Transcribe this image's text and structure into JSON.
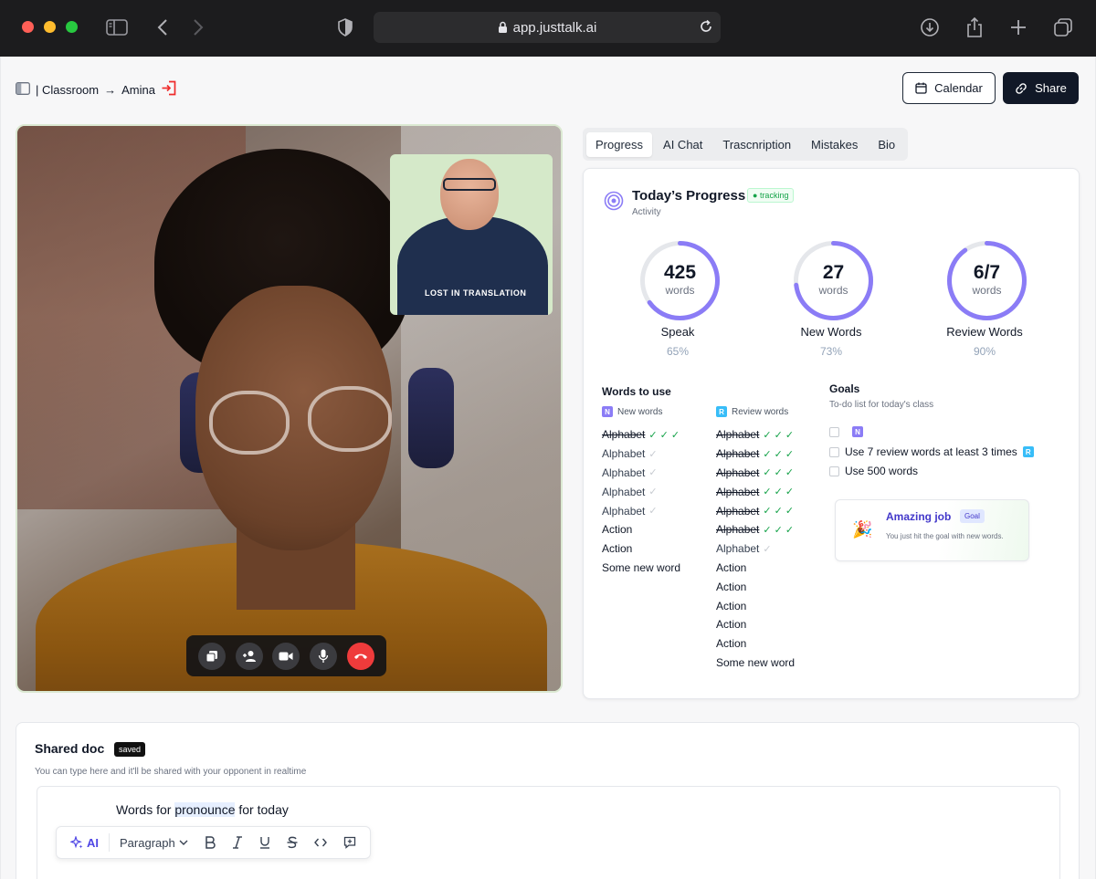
{
  "browser": {
    "url": "app.justtalk.ai"
  },
  "header": {
    "breadcrumb_root": "| Classroom",
    "breadcrumb_arrow": "→",
    "breadcrumb_current": "Amina",
    "calendar_label": "Calendar",
    "share_label": "Share"
  },
  "video": {
    "pip_logo": "LOST IN TRANSLATION"
  },
  "tabs": [
    {
      "label": "Progress",
      "active": true
    },
    {
      "label": "AI Chat",
      "active": false
    },
    {
      "label": "Trascnription",
      "active": false
    },
    {
      "label": "Mistakes",
      "active": false
    },
    {
      "label": "Bio",
      "active": false
    }
  ],
  "progress": {
    "title": "Today’s Progress",
    "badge": "tracking",
    "subtitle": "Activity",
    "accent": "#8b7cf6",
    "stats": [
      {
        "value": "425",
        "unit": "words",
        "label": "Speak",
        "percent_label": "65%",
        "fraction": 0.65
      },
      {
        "value": "27",
        "unit": "words",
        "label": "New Words",
        "percent_label": "73%",
        "fraction": 0.73
      },
      {
        "value": "6/7",
        "unit": "words",
        "label": "Review Words",
        "percent_label": "90%",
        "fraction": 0.9
      }
    ]
  },
  "words": {
    "title": "Words to use",
    "new_header": "New words",
    "new_letter": "N",
    "review_header": "Review words",
    "review_letter": "R",
    "new": [
      {
        "word": "Alphabet",
        "status": "done",
        "checks": "✓ ✓ ✓"
      },
      {
        "word": "Alphabet",
        "status": "partial",
        "checks": "✓"
      },
      {
        "word": "Alphabet",
        "status": "partial",
        "checks": "✓"
      },
      {
        "word": "Alphabet",
        "status": "partial",
        "checks": "✓"
      },
      {
        "word": "Alphabet",
        "status": "partial",
        "checks": "✓"
      },
      {
        "word": "Action",
        "status": "none",
        "checks": ""
      },
      {
        "word": "Action",
        "status": "none",
        "checks": ""
      },
      {
        "word": "Some new word",
        "status": "none",
        "checks": ""
      }
    ],
    "review": [
      {
        "word": "Alphabet",
        "status": "done",
        "checks": "✓ ✓ ✓"
      },
      {
        "word": "Alphabet",
        "status": "done",
        "checks": "✓ ✓ ✓"
      },
      {
        "word": "Alphabet",
        "status": "done",
        "checks": "✓ ✓ ✓"
      },
      {
        "word": "Alphabet",
        "status": "done",
        "checks": "✓ ✓ ✓"
      },
      {
        "word": "Alphabet",
        "status": "done",
        "checks": "✓ ✓ ✓"
      },
      {
        "word": "Alphabet",
        "status": "done",
        "checks": "✓ ✓ ✓"
      },
      {
        "word": "Alphabet",
        "status": "partial",
        "checks": "✓"
      },
      {
        "word": "Action",
        "status": "none",
        "checks": ""
      },
      {
        "word": "Action",
        "status": "none",
        "checks": ""
      },
      {
        "word": "Action",
        "status": "none",
        "checks": ""
      },
      {
        "word": "Action",
        "status": "none",
        "checks": ""
      },
      {
        "word": "Action",
        "status": "none",
        "checks": ""
      },
      {
        "word": "Some new word",
        "status": "none",
        "checks": ""
      }
    ]
  },
  "goals": {
    "title": "Goals",
    "subtitle": "To-do list for today's class",
    "item1_badge": "N",
    "item2_text": "Use 7 review words at least 3 times",
    "item2_badge": "R",
    "item3_text": "Use 500 words",
    "congrats_title": "Amazing job",
    "congrats_badge": "Goal",
    "congrats_text": "You just hit the goal with new words."
  },
  "doc": {
    "title": "Shared doc",
    "saved_badge": "saved",
    "subtitle": "You can type here and it'll be shared with your opponent in realtime",
    "text_before": "Words for ",
    "text_highlight": "pronounce",
    "text_after": " for today",
    "toolbar": {
      "ai_label": "AI",
      "format_label": "Paragraph"
    }
  }
}
